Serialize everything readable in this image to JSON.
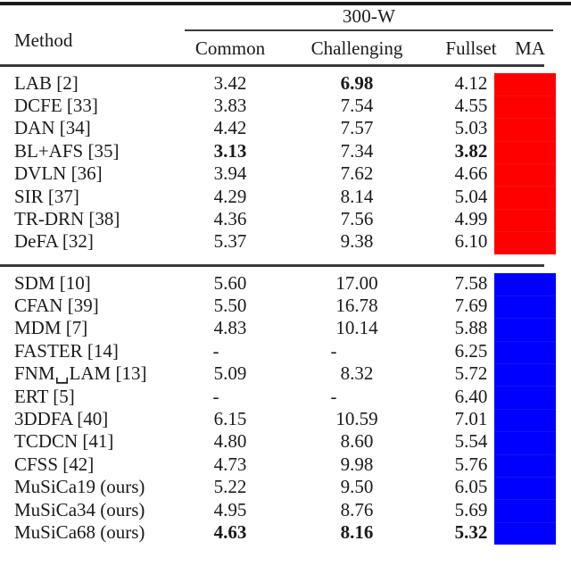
{
  "table": {
    "group_header": "300-W",
    "columns": {
      "method": "Method",
      "common": "Common",
      "challenging": "Challenging",
      "fullset": "Fullset",
      "ma": "MA"
    },
    "sections": [
      {
        "id": "section-red",
        "block_color": "#FE0000",
        "rows": [
          {
            "method": "LAB [2]",
            "common": "3.42",
            "challenging": "6.98",
            "fullset": "4.12",
            "bold": {
              "common": false,
              "challenging": true,
              "fullset": false
            }
          },
          {
            "method": "DCFE [33]",
            "common": "3.83",
            "challenging": "7.54",
            "fullset": "4.55",
            "bold": {
              "common": false,
              "challenging": false,
              "fullset": false
            }
          },
          {
            "method": "DAN [34]",
            "common": "4.42",
            "challenging": "7.57",
            "fullset": "5.03",
            "bold": {
              "common": false,
              "challenging": false,
              "fullset": false
            }
          },
          {
            "method": "BL+AFS [35]",
            "common": "3.13",
            "challenging": "7.34",
            "fullset": "3.82",
            "bold": {
              "common": true,
              "challenging": false,
              "fullset": true
            }
          },
          {
            "method": "DVLN [36]",
            "common": "3.94",
            "challenging": "7.62",
            "fullset": "4.66",
            "bold": {
              "common": false,
              "challenging": false,
              "fullset": false
            }
          },
          {
            "method": "SIR [37]",
            "common": "4.29",
            "challenging": "8.14",
            "fullset": "5.04",
            "bold": {
              "common": false,
              "challenging": false,
              "fullset": false
            }
          },
          {
            "method": "TR-DRN [38]",
            "common": "4.36",
            "challenging": "7.56",
            "fullset": "4.99",
            "bold": {
              "common": false,
              "challenging": false,
              "fullset": false
            }
          },
          {
            "method": "DeFA [32]",
            "common": "5.37",
            "challenging": "9.38",
            "fullset": "6.10",
            "bold": {
              "common": false,
              "challenging": false,
              "fullset": false
            }
          }
        ]
      },
      {
        "id": "section-blue",
        "block_color": "#0000FE",
        "rows": [
          {
            "method": "SDM [10]",
            "common": "5.60",
            "challenging": "17.00",
            "fullset": "7.58",
            "bold": {
              "common": false,
              "challenging": false,
              "fullset": false
            }
          },
          {
            "method": "CFAN [39]",
            "common": "5.50",
            "challenging": "16.78",
            "fullset": "7.69",
            "bold": {
              "common": false,
              "challenging": false,
              "fullset": false
            }
          },
          {
            "method": "MDM [7]",
            "common": "4.83",
            "challenging": "10.14",
            "fullset": "5.88",
            "bold": {
              "common": false,
              "challenging": false,
              "fullset": false
            }
          },
          {
            "method": "FASTER [14]",
            "common": "-",
            "challenging": "-",
            "fullset": "6.25",
            "bold": {
              "common": false,
              "challenging": false,
              "fullset": false
            }
          },
          {
            "method": "FNM␣LAM [13]",
            "common": "5.09",
            "challenging": "8.32",
            "fullset": "5.72",
            "bold": {
              "common": false,
              "challenging": false,
              "fullset": false
            }
          },
          {
            "method": "ERT [5]",
            "common": "-",
            "challenging": "-",
            "fullset": "6.40",
            "bold": {
              "common": false,
              "challenging": false,
              "fullset": false
            }
          },
          {
            "method": "3DDFA [40]",
            "common": "6.15",
            "challenging": "10.59",
            "fullset": "7.01",
            "bold": {
              "common": false,
              "challenging": false,
              "fullset": false
            }
          },
          {
            "method": "TCDCN [41]",
            "common": "4.80",
            "challenging": "8.60",
            "fullset": "5.54",
            "bold": {
              "common": false,
              "challenging": false,
              "fullset": false
            }
          },
          {
            "method": "CFSS [42]",
            "common": "4.73",
            "challenging": "9.98",
            "fullset": "5.76",
            "bold": {
              "common": false,
              "challenging": false,
              "fullset": false
            }
          },
          {
            "method": "MuSiCa19 (ours)",
            "common": "5.22",
            "challenging": "9.50",
            "fullset": "6.05",
            "bold": {
              "common": false,
              "challenging": false,
              "fullset": false
            }
          },
          {
            "method": "MuSiCa34 (ours)",
            "common": "4.95",
            "challenging": "8.76",
            "fullset": "5.69",
            "bold": {
              "common": false,
              "challenging": false,
              "fullset": false
            }
          },
          {
            "method": "MuSiCa68 (ours)",
            "common": "4.63",
            "challenging": "8.16",
            "fullset": "5.32",
            "bold": {
              "common": true,
              "challenging": true,
              "fullset": true
            }
          }
        ]
      }
    ]
  }
}
